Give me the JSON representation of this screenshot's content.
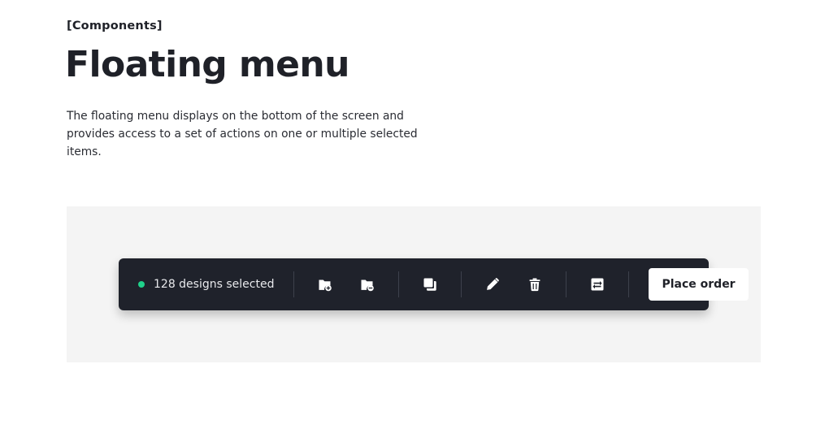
{
  "header": {
    "eyebrow": "[Components]",
    "title": "Floating menu",
    "description": "The floating menu displays on the bottom of the screen and provides access to a set of actions on one or multiple selected items."
  },
  "floating_menu": {
    "status_text": "128 designs selected",
    "status_color": "#1fd18a",
    "actions": [
      {
        "icon": "folder-add-icon"
      },
      {
        "icon": "folder-remove-icon"
      },
      {
        "icon": "duplicate-icon"
      },
      {
        "icon": "pencil-icon"
      },
      {
        "icon": "trash-icon"
      },
      {
        "icon": "swap-icon"
      }
    ],
    "primary_label": "Place order"
  },
  "colors": {
    "menu_background": "#1f222b",
    "demo_background": "#f4f4f4",
    "text_dark": "#1f2128"
  }
}
